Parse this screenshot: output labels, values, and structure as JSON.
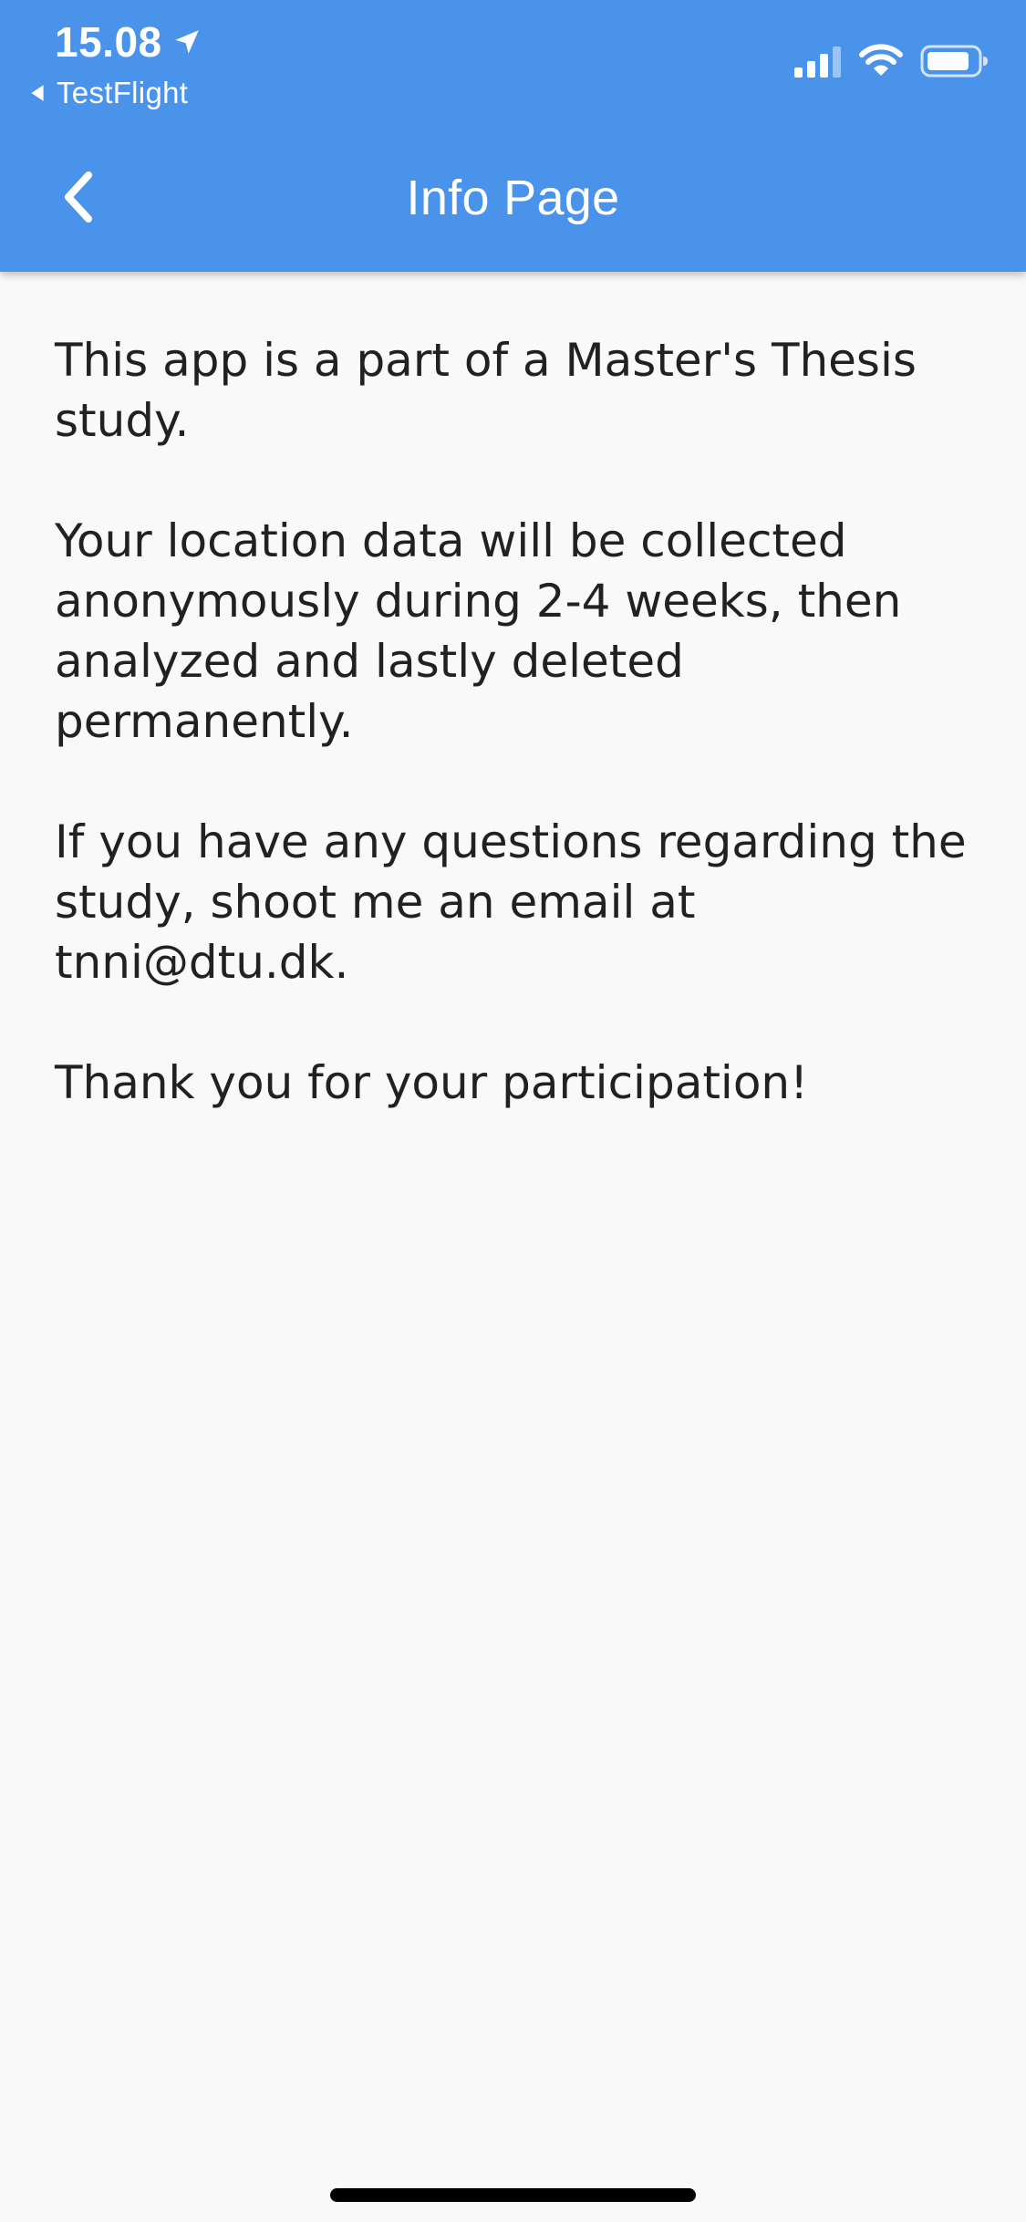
{
  "status_bar": {
    "time": "15.08",
    "back_to_app_label": "TestFlight"
  },
  "app_bar": {
    "title": "Info Page"
  },
  "content": {
    "paragraphs": [
      "This app is a part of a Master's Thesis\nstudy.",
      "Your location data will be collected\nanonymously during 2-4 weeks, then\nanalyzed and lastly deleted\npermanently.",
      "If you have any questions regarding the\nstudy, shoot me an email at\ntnni@dtu.dk.",
      "Thank you for your participation!"
    ]
  },
  "colors": {
    "app_bar_background": "#4a93ea",
    "page_background": "#f9f9f9",
    "body_text": "#212121",
    "app_bar_text": "#ffffff"
  },
  "icons": {
    "location_arrow": "location-arrow-icon",
    "back_to_app": "back-triangle-icon",
    "signal": "signal-icon",
    "wifi": "wifi-icon",
    "battery": "battery-icon",
    "back": "chevron-left-icon"
  }
}
